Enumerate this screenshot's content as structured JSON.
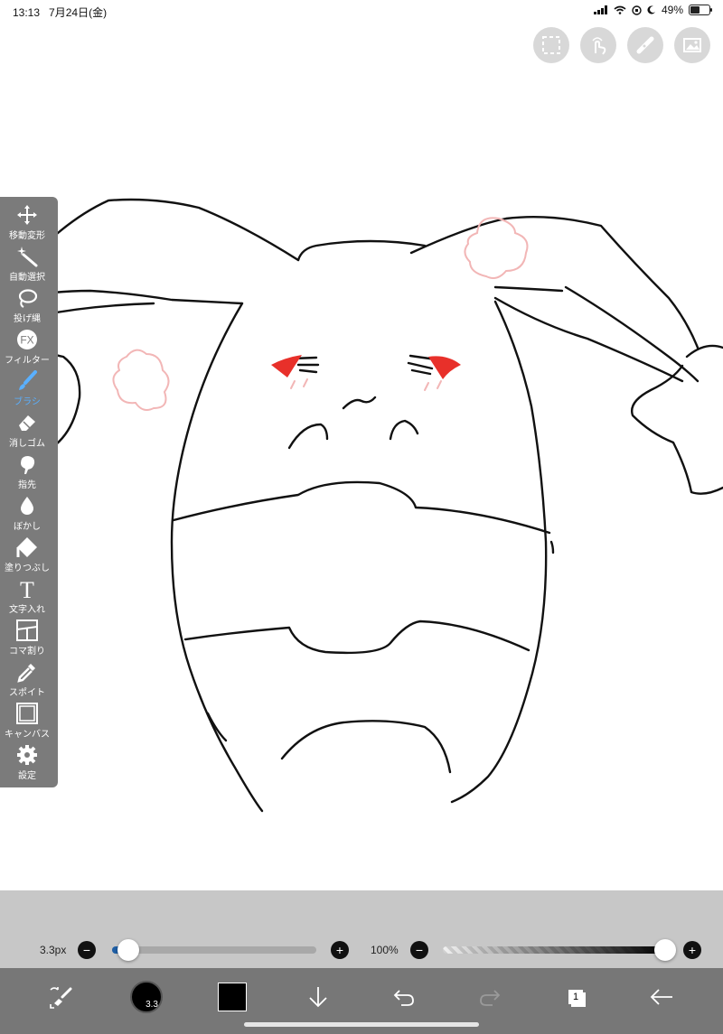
{
  "status": {
    "time": "13:13",
    "date": "7月24日(金)",
    "battery": "49%",
    "battery_level": 0.49
  },
  "top_tools": [
    "selection-icon",
    "gesture-icon",
    "ruler-icon",
    "image-icon"
  ],
  "toolbar": {
    "items": [
      {
        "label": "移動変形",
        "icon": "move-icon"
      },
      {
        "label": "自動選択",
        "icon": "magic-wand-icon"
      },
      {
        "label": "投げ縄",
        "icon": "lasso-icon"
      },
      {
        "label": "フィルター",
        "icon": "fx-icon",
        "icon_text": "FX"
      },
      {
        "label": "ブラシ",
        "icon": "brush-icon",
        "active": true
      },
      {
        "label": "消しゴム",
        "icon": "eraser-icon"
      },
      {
        "label": "指先",
        "icon": "finger-icon"
      },
      {
        "label": "ぼかし",
        "icon": "blur-icon"
      },
      {
        "label": "塗りつぶし",
        "icon": "bucket-icon"
      },
      {
        "label": "文字入れ",
        "icon": "text-icon",
        "icon_text": "T"
      },
      {
        "label": "コマ割り",
        "icon": "panel-icon"
      },
      {
        "label": "スポイト",
        "icon": "eyedropper-icon"
      },
      {
        "label": "キャンバス",
        "icon": "canvas-icon"
      },
      {
        "label": "設定",
        "icon": "settings-icon"
      }
    ]
  },
  "brush_panel": {
    "size_label": "3.3px",
    "size_fraction": 0.08,
    "opacity_label": "100%",
    "opacity_fraction": 1.0,
    "minus": "−",
    "plus": "+"
  },
  "bottom_bar": {
    "brush_size_badge": "3.3",
    "color": "#000000",
    "layer_count": "1",
    "icons": [
      "transform-icon",
      "brush-size-icon",
      "color-icon",
      "download-icon",
      "undo-icon",
      "redo-icon",
      "layers-icon",
      "back-icon"
    ]
  },
  "colors": {
    "accent": "#1f5fa5",
    "toolbar_bg": "#7b7b7b",
    "panel_bg": "#c7c7c7",
    "sketch_red": "#e8302a",
    "sketch_pink": "#f2b6b6"
  }
}
